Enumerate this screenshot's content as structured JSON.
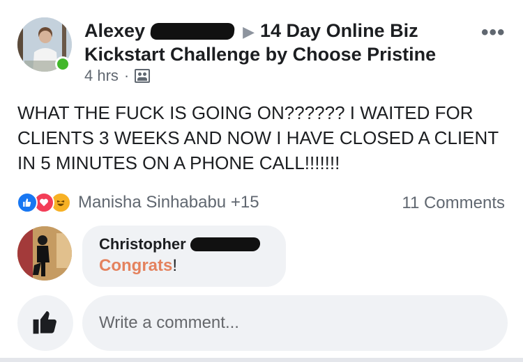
{
  "post": {
    "author_first": "Alexey",
    "group": "14 Day Online Biz Kickstart Challenge by Choose Pristine",
    "time": "4 hrs",
    "separator": "·",
    "text": "WHAT THE FUCK IS GOING ON?????? I WAITED FOR CLIENTS 3 WEEKS AND NOW I HAVE CLOSED A CLIENT IN 5 MINUTES ON A PHONE CALL!!!!!!!",
    "reactions_names": "Manisha Sinhababu +15",
    "comments_count": "11 Comments"
  },
  "comment": {
    "author_first": "Christopher",
    "text_highlight": "Congrats",
    "text_rest": "!"
  },
  "composer": {
    "placeholder": "Write a comment..."
  },
  "icons": {
    "more": "ellipsis-icon",
    "privacy": "group-icon",
    "like": "thumbs-up-icon"
  },
  "colors": {
    "online": "#42b72a",
    "like": "#1877f2",
    "love": "#f33e58",
    "haha": "#f7b125",
    "highlight": "#e4825e"
  }
}
